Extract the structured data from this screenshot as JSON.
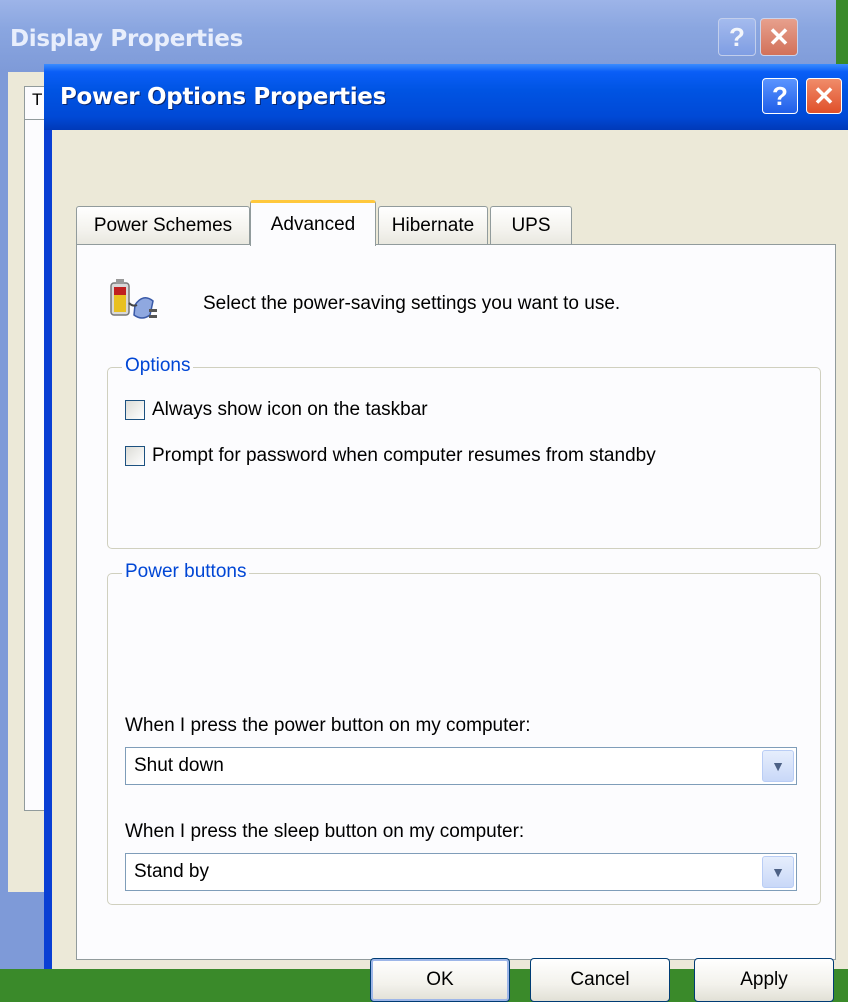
{
  "background_window": {
    "title": "Display Properties",
    "tab_peek_letter": "T",
    "help_glyph": "?",
    "close_glyph": "✕"
  },
  "window": {
    "title": "Power Options Properties",
    "help_glyph": "?",
    "close_glyph": "✕",
    "help_icon": "help-icon",
    "close_icon": "close-icon"
  },
  "tabs": [
    {
      "label": "Power Schemes",
      "active": false
    },
    {
      "label": "Advanced",
      "active": true
    },
    {
      "label": "Hibernate",
      "active": false
    },
    {
      "label": "UPS",
      "active": false
    }
  ],
  "advanced": {
    "icon": "power-plug-battery-icon",
    "intro": "Select the power-saving settings you want to use.",
    "options": {
      "label": "Options",
      "checkboxes": [
        {
          "label": "Always show icon on the taskbar",
          "checked": false
        },
        {
          "label": "Prompt for password when computer resumes from standby",
          "checked": false
        }
      ]
    },
    "power_buttons": {
      "label": "Power buttons",
      "power_button_label": "When I press the power button on my computer:",
      "power_button_value": "Shut down",
      "sleep_button_label": "When I press the sleep button on my computer:",
      "sleep_button_value": "Stand by"
    }
  },
  "buttons": {
    "ok": "OK",
    "cancel": "Cancel",
    "apply": "Apply"
  },
  "colors": {
    "title_bar": "#0054e3",
    "dialog_face": "#ece9d8",
    "group_label": "#0046d5",
    "active_tab_accent": "#ffc83c"
  }
}
